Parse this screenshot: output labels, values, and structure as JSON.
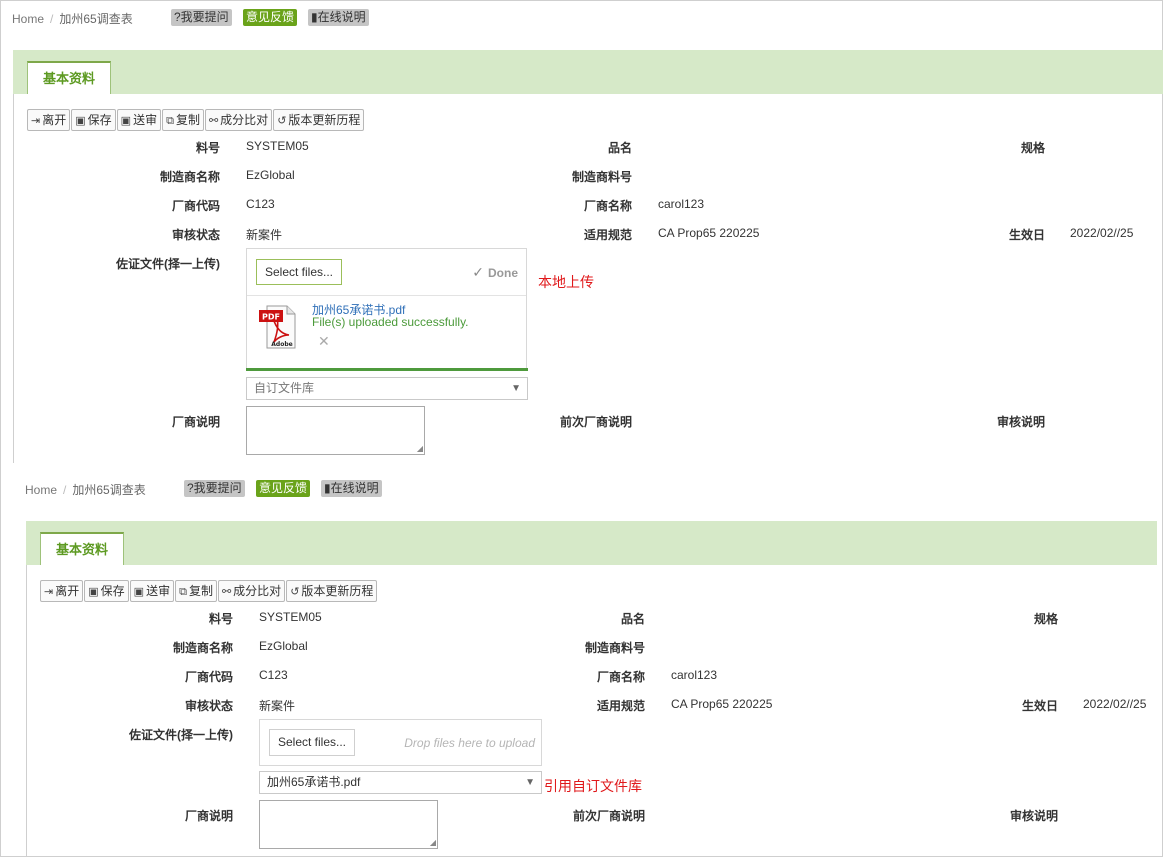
{
  "breadcrumb": {
    "home": "Home",
    "sep": "/",
    "current": "加州65调查表"
  },
  "header_buttons": {
    "ask": "?我要提问",
    "feedback": "意见反馈",
    "help": "在线说明"
  },
  "tab": {
    "label": "基本资料"
  },
  "toolbar": {
    "leave": "离开",
    "save": "保存",
    "submit": "送审",
    "copy": "复制",
    "compare": "成分比对",
    "history": "版本更新历程"
  },
  "form": {
    "item_no_label": "料号",
    "item_no": "SYSTEM05",
    "product_name_label": "品名",
    "spec_label": "规格",
    "maker_name_label": "制造商名称",
    "maker_name": "EzGlobal",
    "maker_item_label": "制造商料号",
    "vendor_code_label": "厂商代码",
    "vendor_code": "C123",
    "vendor_name_label": "厂商名称",
    "vendor_name": "carol123",
    "review_status_label": "审核状态",
    "review_status": "新案件",
    "regulation_label": "适用规范",
    "regulation": "CA Prop65 220225",
    "effective_label": "生效日",
    "effective": "2022/02//25",
    "evidence_label": "佐证文件(择一上传)",
    "vendor_note_label": "厂商说明",
    "prev_vendor_note_label": "前次厂商说明",
    "review_note_label": "审核说明"
  },
  "upload1": {
    "select_label": "Select files...",
    "done_label": "Done",
    "file_name": "加州65承诺书.pdf",
    "file_status": "File(s) uploaded successfully.",
    "library_placeholder": "自订文件库",
    "note": "本地上传"
  },
  "upload2": {
    "select_label": "Select files...",
    "drop_hint": "Drop files here to upload",
    "library_value": "加州65承诺书.pdf",
    "note": "引用自订文件库"
  },
  "icons": {
    "check": "✓",
    "remove": "✕",
    "dropdown": "▼"
  }
}
